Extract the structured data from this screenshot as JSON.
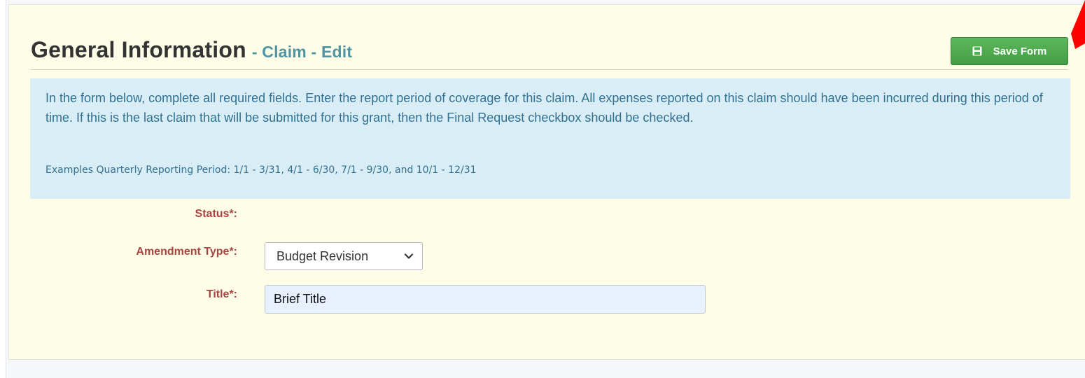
{
  "header": {
    "title": "General Information",
    "subtitle": "- Claim - Edit",
    "save_label": "Save Form"
  },
  "info": {
    "paragraph": "In the form below, complete all required fields. Enter the report period of coverage for this claim. All expenses reported on this claim should have been incurred during this period of time. If this is the last claim that will be submitted for this grant, then the Final Request checkbox should be checked.",
    "example": "Examples Quarterly Reporting Period: 1/1 - 3/31, 4/1 - 6/30, 7/1 - 9/30, and 10/1 - 12/31"
  },
  "form": {
    "status_label": "Status*:",
    "amendment_label": "Amendment Type*:",
    "amendment_value": "Budget Revision",
    "title_label": "Title*:",
    "title_value": "Brief Title"
  },
  "colors": {
    "panel_bg": "#fdfde8",
    "info_bg": "#d9edf7",
    "info_text": "#31708f",
    "label_red": "#a94442",
    "subtitle_teal": "#4f94a3",
    "button_green": "#5cb85c",
    "annotation_arrow": "#ff0000"
  },
  "icons": {
    "save": "floppy-disk-icon",
    "dropdown": "chevron-down-icon"
  }
}
